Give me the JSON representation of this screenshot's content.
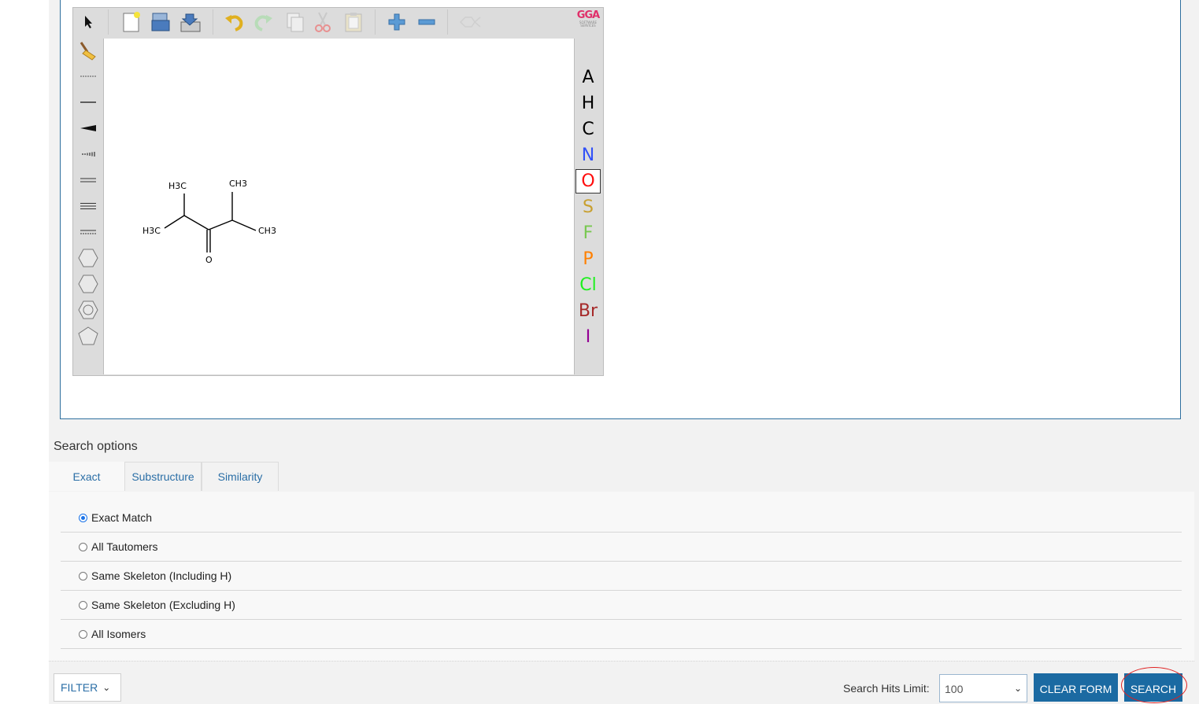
{
  "editor": {
    "toolbar_icons": [
      "pointer-icon",
      "new-file-icon",
      "open-file-icon",
      "save-file-icon",
      "undo-icon",
      "redo-icon",
      "copy-icon",
      "cut-icon",
      "paste-icon",
      "zoom-in-icon",
      "zoom-out-icon",
      "clean-structure-icon"
    ],
    "left_tools": [
      "eraser-icon",
      "any-bond-icon",
      "single-bond-icon",
      "wedge-bond-icon",
      "hash-bond-icon",
      "double-bond-icon",
      "triple-bond-icon",
      "aromatic-bond-icon",
      "benzene-ring-icon",
      "cyclohexane-icon",
      "cyclopentadiene-ring-icon",
      "cyclopentane-icon"
    ],
    "logo": {
      "text": "GGA",
      "sub": "SOFTWARE SERVICES"
    },
    "atoms": [
      {
        "label": "A",
        "color": "#000000"
      },
      {
        "label": "H",
        "color": "#000000"
      },
      {
        "label": "C",
        "color": "#000000"
      },
      {
        "label": "N",
        "color": "#3050f8"
      },
      {
        "label": "O",
        "color": "#ff0d0d",
        "selected": true
      },
      {
        "label": "S",
        "color": "#c8a030"
      },
      {
        "label": "F",
        "color": "#78c850"
      },
      {
        "label": "P",
        "color": "#ff8000"
      },
      {
        "label": "Cl",
        "color": "#1ff01f"
      },
      {
        "label": "Br",
        "color": "#a62929"
      },
      {
        "label": "I",
        "color": "#940094"
      }
    ],
    "molecule_labels": {
      "ch3_top": "CH3",
      "h3c_top": "H3C",
      "h3c_left": "H3C",
      "ch3_right": "CH3",
      "oxygen": "O"
    }
  },
  "search_options": {
    "title": "Search options",
    "tabs": [
      {
        "label": "Exact",
        "active": true
      },
      {
        "label": "Substructure",
        "active": false
      },
      {
        "label": "Similarity",
        "active": false
      }
    ],
    "options": [
      {
        "label": "Exact Match",
        "checked": true
      },
      {
        "label": "All Tautomers",
        "checked": false
      },
      {
        "label": "Same Skeleton (Including H)",
        "checked": false
      },
      {
        "label": "Same Skeleton (Excluding H)",
        "checked": false
      },
      {
        "label": "All Isomers",
        "checked": false
      }
    ]
  },
  "footer": {
    "filter_label": "FILTER",
    "hits_label": "Search Hits Limit:",
    "hits_value": "100",
    "clear_label": "CLEAR FORM",
    "search_label": "SEARCH"
  },
  "colors": {
    "accent": "#1b6aa2",
    "link": "#2a6ea6",
    "annotation": "#e02020"
  }
}
